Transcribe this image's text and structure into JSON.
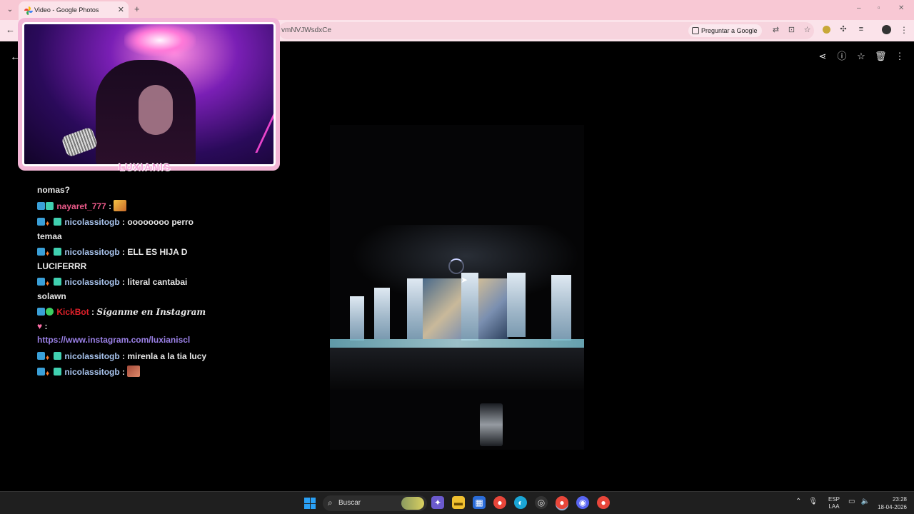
{
  "browser": {
    "tab_title": "Video - Google Photos",
    "url_fragment": "vmNVJWsdxCe",
    "ask_button": "Preguntar a Google"
  },
  "chat": {
    "messages": [
      {
        "user": "",
        "text": "nomas?"
      },
      {
        "user": "nayaret_777",
        "sep": " : ",
        "emote": "party-emote"
      },
      {
        "user": "nicolassitogb",
        "sep": " : ",
        "text": "oooooooo perro temaa"
      },
      {
        "user": "nicolassitogb",
        "sep": " : ",
        "text": "ELL ES HIJA D LUCIFERRR"
      },
      {
        "user": "nicolassitogb",
        "sep": " : ",
        "text": "literal cantabai solawn"
      },
      {
        "user": "KickBot",
        "sep": " : ",
        "text": "Síganme en Instagram",
        "after": ":",
        "link": "https://www.instagram.com/luxianiscl"
      },
      {
        "user": "nicolassitogb",
        "sep": " : ",
        "text": "mirenla a la tia lucy"
      },
      {
        "user": "nicolassitogb",
        "sep": " : ",
        "emote": "face-emote"
      }
    ]
  },
  "webcam": {
    "logo_text": "LUXIANIS"
  },
  "taskbar": {
    "search_placeholder": "Buscar",
    "lang_top": "ESP",
    "lang_bottom": "LAA",
    "time": "23:28",
    "date": "18-04-2026"
  },
  "colors": {
    "tabstrip": "#f8c8d4",
    "toolbar": "#fbe3ea",
    "chat_user_pink": "#ec5a8a",
    "chat_user_blue": "#a9c5ef",
    "kickbot_red": "#e0202a",
    "link": "#9a80e6"
  }
}
